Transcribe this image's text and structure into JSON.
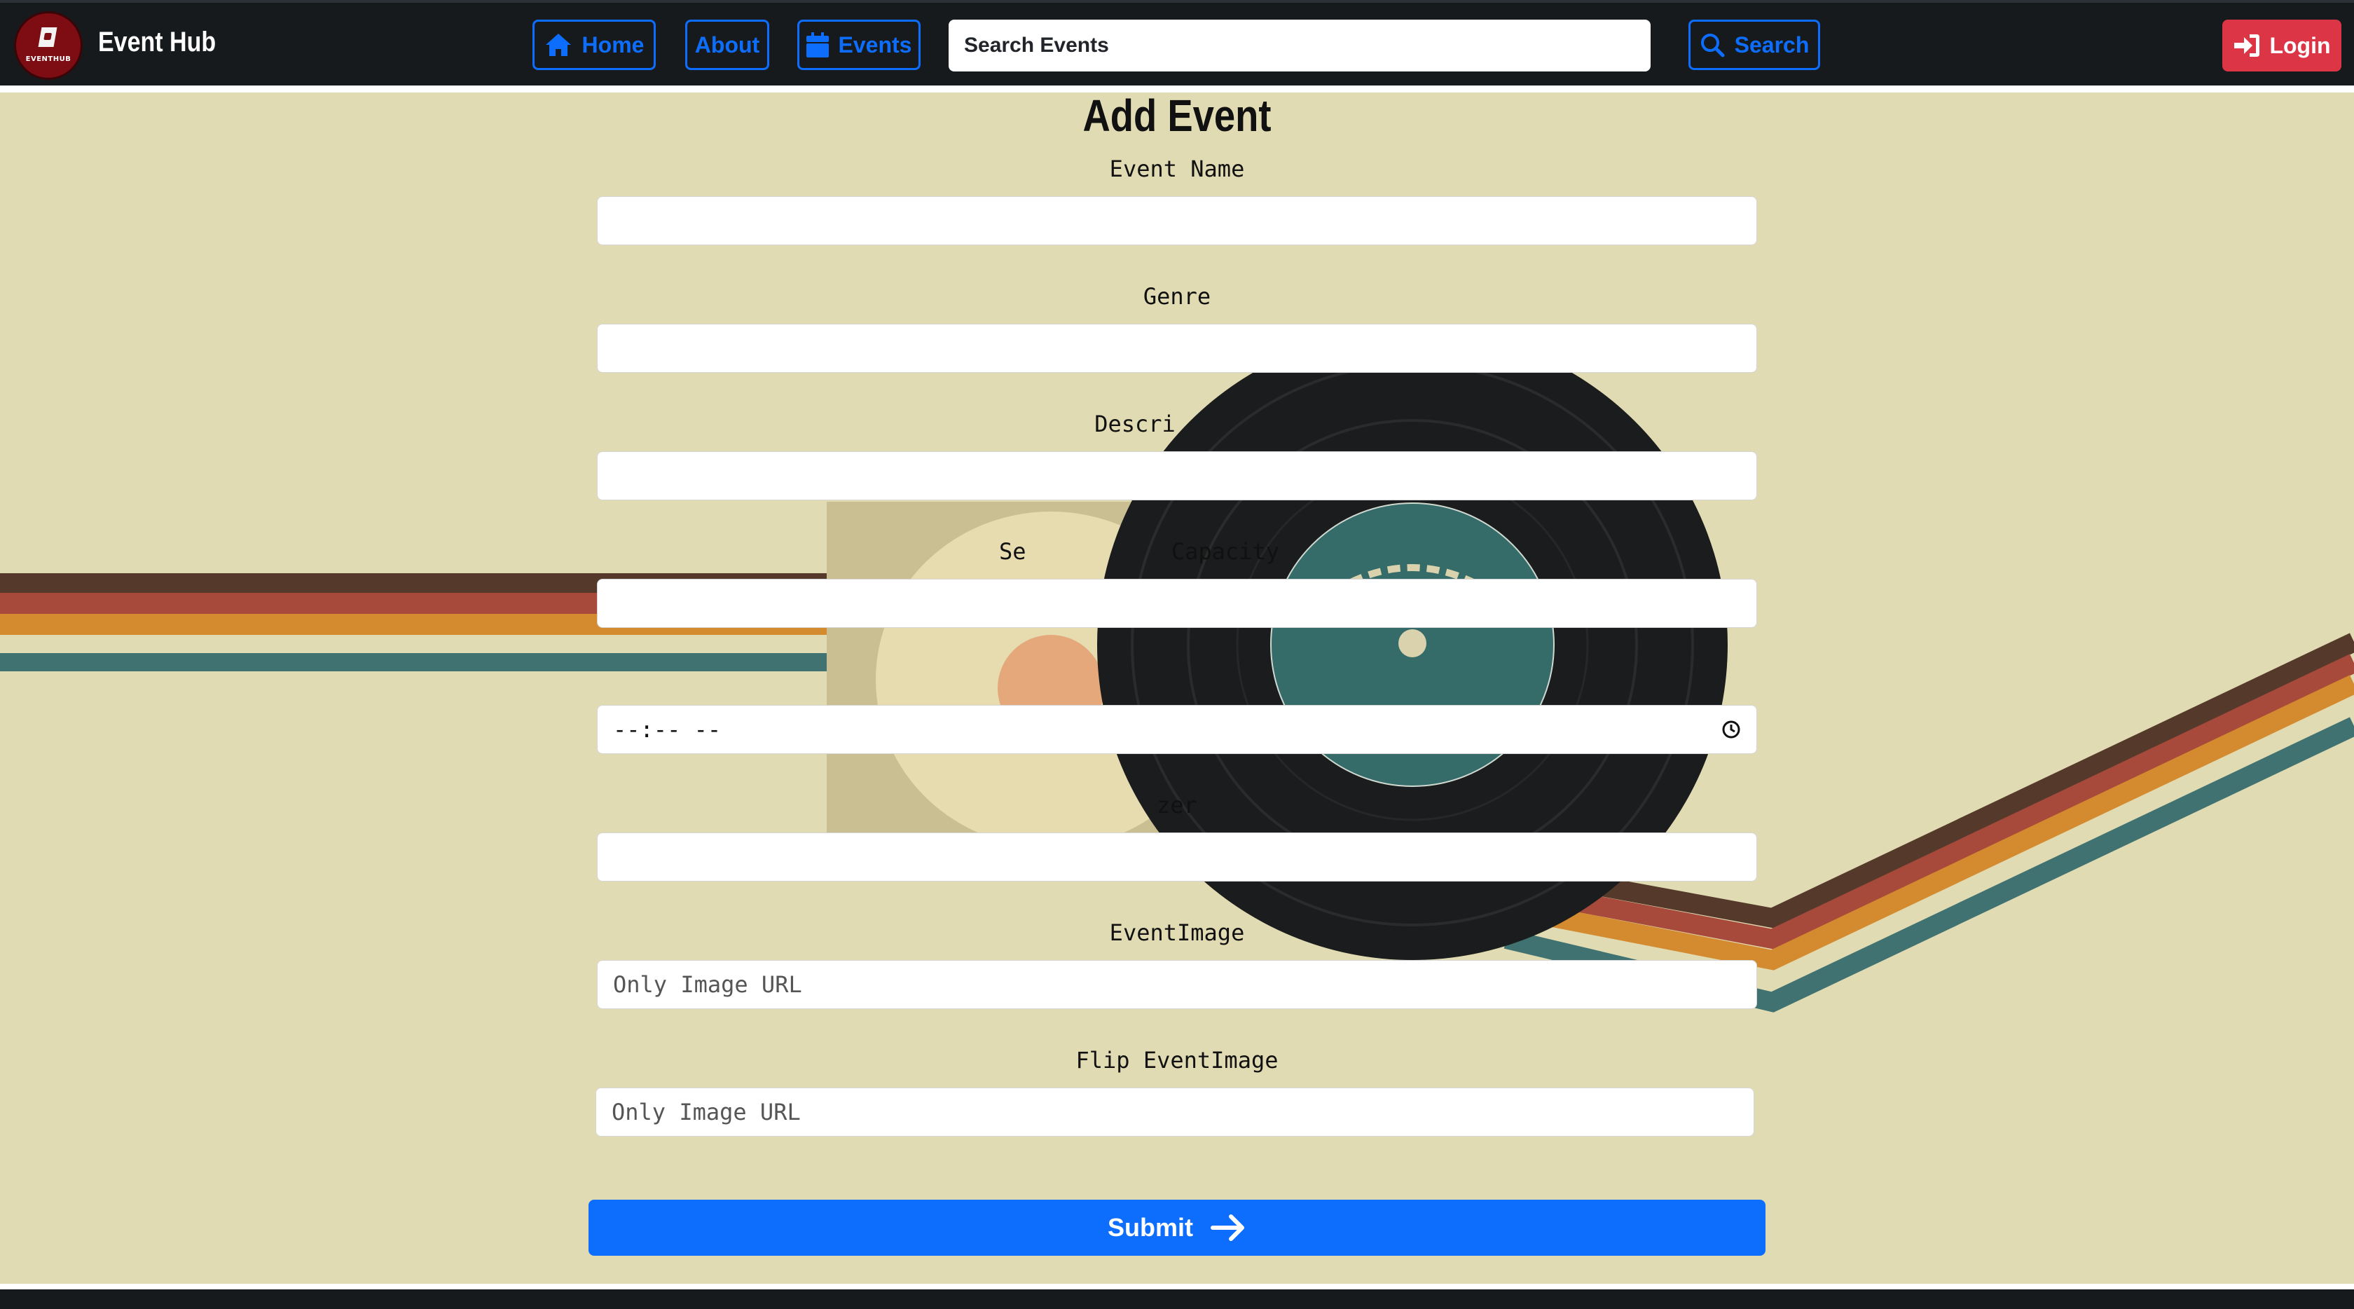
{
  "nav": {
    "logo_text": "EVENTHUB",
    "brand": "Event Hub",
    "home": "Home",
    "about": "About",
    "events": "Events",
    "search_placeholder": "Search Events",
    "search_button": "Search",
    "login": "Login"
  },
  "form": {
    "title": "Add Event",
    "event_name_label": "Event Name",
    "genre_label": "Genre",
    "description_label": "Descri",
    "seating_label_left": "Se",
    "seating_label_right": "Capacity",
    "time_value": "--:-- --",
    "organizer_label": "zer",
    "event_image_label": "EventImage",
    "event_image_placeholder": "Only Image URL",
    "flip_image_label": "Flip EventImage",
    "flip_image_placeholder": "Only Image URL",
    "submit": "Submit"
  },
  "colors": {
    "background": "#e1dbb3",
    "navbar": "#171a1d",
    "primary": "#0d6efd",
    "danger": "#dc3545",
    "stripes": [
      "#553a2c",
      "#a84a3b",
      "#d48a2e",
      "#3f7270"
    ]
  },
  "icons": [
    "home-icon",
    "calendar-icon",
    "search-icon",
    "login-icon",
    "clock-icon",
    "arrow-right-icon"
  ]
}
